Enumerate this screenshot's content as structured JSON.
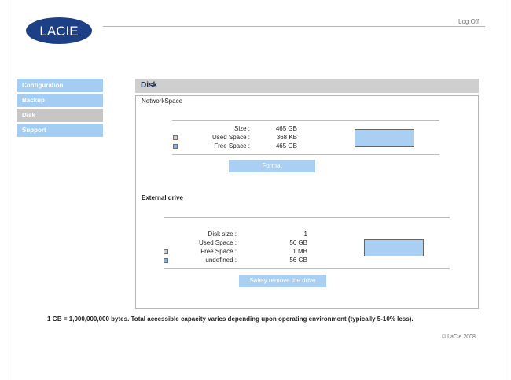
{
  "header": {
    "logo_text": "LACIE",
    "logoff_label": "Log Off"
  },
  "nav": {
    "items": [
      {
        "label": "Configuration"
      },
      {
        "label": "Backup"
      },
      {
        "label": "Disk"
      },
      {
        "label": "Support"
      }
    ],
    "active": "Disk"
  },
  "section": {
    "title": "Disk"
  },
  "network": {
    "title": "NetworkSpace",
    "size_label": "Size :",
    "size_value": "465 GB",
    "used_label": "Used Space :",
    "used_value": "368 KB",
    "free_label": "Free Space :",
    "free_value": "465 GB",
    "format_label": "Format",
    "used_fraction": 0.0
  },
  "external": {
    "title": "External drive",
    "disksize_label": "Disk size :",
    "disksize_value": "1",
    "used_label": "Used Space :",
    "used_value": "56 GB",
    "free_label": "Free Space :",
    "free_value": "1 MB",
    "undefined_label": "undefined :",
    "undefined_value": "56 GB",
    "remove_label": "Safely remove the drive"
  },
  "footnote": "1 GB = 1,000,000,000 bytes. Total accessible capacity varies depending upon operating environment (typically 5-10% less).",
  "copyright": "© LaCie 2008",
  "colors": {
    "accent": "#a9d0f3",
    "nav": "#a4cdf4",
    "active": "#c6c6c6",
    "logo": "#1d3f86"
  }
}
